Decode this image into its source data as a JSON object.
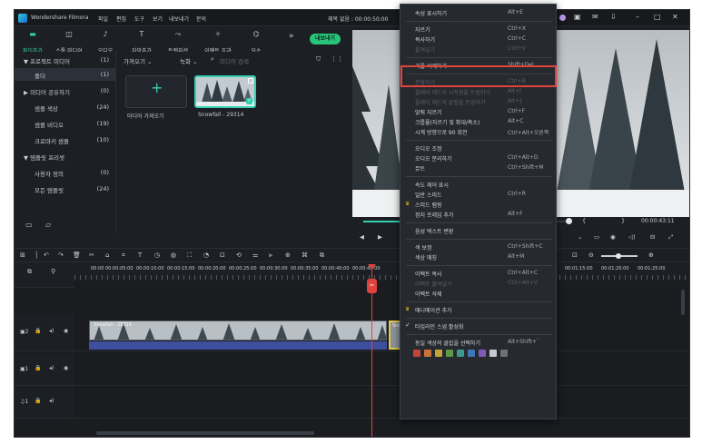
{
  "app": {
    "name": "Wondershare Filmora",
    "menus": [
      "파일",
      "편집",
      "도구",
      "보기",
      "내보내기",
      "문의"
    ],
    "project_title": "제목 없음 : 00:00:50:00"
  },
  "toolbar": {
    "tools": [
      {
        "label": "파일추가",
        "icon": "folder-icon",
        "active": true
      },
      {
        "label": "스톡 미디어",
        "icon": "stock-media-icon"
      },
      {
        "label": "오디오",
        "icon": "music-note-icon"
      },
      {
        "label": "자막추가",
        "icon": "text-icon"
      },
      {
        "label": "트랜지션",
        "icon": "transition-icon"
      },
      {
        "label": "이펙트 효과",
        "icon": "effects-icon"
      },
      {
        "label": "요소",
        "icon": "elements-icon"
      }
    ],
    "more": "»",
    "export_label": "내보내기"
  },
  "left_panel": {
    "items": [
      {
        "label": "▼ 프로젝트 미디어",
        "count": "(1)"
      },
      {
        "label": "폴더",
        "count": "(1)",
        "selected": true
      },
      {
        "label": "▶ 미디어 공유하기",
        "count": "(0)"
      },
      {
        "label": "샘플 색상",
        "count": "(24)"
      },
      {
        "label": "샘플 비디오",
        "count": "(19)"
      },
      {
        "label": "크로마키 샘플",
        "count": "(10)"
      },
      {
        "label": "▼ 템플릿 프리셋",
        "count": ""
      },
      {
        "label": "사용자 정의",
        "count": "(0)"
      },
      {
        "label": "모든 템플릿",
        "count": "(24)"
      }
    ]
  },
  "media": {
    "import_dropdown": "가져오기",
    "record_dropdown": "녹화",
    "search_placeholder": "미디어 검색",
    "import_label": "미디어 가져오기",
    "clip_name": "Snowfall - 29314"
  },
  "preview": {
    "timecode": "00:00:43:11",
    "brace_open": "{",
    "brace_close": "}"
  },
  "timeline": {
    "ruler_ticks": [
      "00:00",
      "00:00:05:00",
      "00:00:10:00",
      "00:00:15:00",
      "00:00:20:00",
      "00:00:25:00",
      "00:00:30:00",
      "00:00:35:00",
      "00:00:40:00",
      "00:00:45:00"
    ],
    "ruler_ticks_right": [
      "00:01:15:00",
      "00:01:20:00",
      "00:01:25:00"
    ],
    "clip1_name": "Snowfall - 29314",
    "clip2_name": "Sno",
    "tracks": [
      {
        "label": "2"
      },
      {
        "label": "1"
      },
      {
        "label": "1"
      }
    ]
  },
  "context_menu": {
    "items": [
      {
        "label": "속성 표시하기",
        "shortcut": "Alt+E",
        "enabled": true
      },
      {
        "sep": true
      },
      {
        "label": "자르기",
        "shortcut": "Ctrl+X",
        "enabled": true
      },
      {
        "label": "복사하기",
        "shortcut": "Ctrl+C",
        "enabled": true
      },
      {
        "label": "붙여넣기",
        "shortcut": "Ctrl+V",
        "enabled": false
      },
      {
        "sep": true
      },
      {
        "label": "리플 삭제하기",
        "shortcut": "Shift+Del",
        "enabled": true,
        "highlighted": true
      },
      {
        "sep": true
      },
      {
        "label": "분할하기",
        "shortcut": "Ctrl+B",
        "enabled": false
      },
      {
        "label": "플레이 헤드의 시작점을 트림하기",
        "shortcut": "Alt+[",
        "enabled": false
      },
      {
        "label": "플레이 헤드의 끝점을 트림하기",
        "shortcut": "Alt+]",
        "enabled": false
      },
      {
        "label": "맞춰 자르기",
        "shortcut": "Ctrl+F",
        "enabled": true
      },
      {
        "label": "크롭퓰(자르기 및 확대/축소)",
        "shortcut": "Alt+C",
        "enabled": true
      },
      {
        "label": "시계 방향으로 90 회전",
        "shortcut": "Ctrl+Alt+오른쪽",
        "enabled": true
      },
      {
        "sep": true
      },
      {
        "label": "오디오 조정",
        "shortcut": "",
        "enabled": true
      },
      {
        "label": "오디오 분리하기",
        "shortcut": "Ctrl+Alt+D",
        "enabled": true
      },
      {
        "label": "뮤트",
        "shortcut": "Ctrl+Shift+M",
        "enabled": true
      },
      {
        "sep": true
      },
      {
        "label": "속도 제어 표시",
        "shortcut": "",
        "enabled": true
      },
      {
        "label": "일반 스피드",
        "shortcut": "Ctrl+R",
        "enabled": true
      },
      {
        "label": "스피드 램핑",
        "shortcut": "",
        "enabled": true,
        "crown": true
      },
      {
        "label": "정지 프레임 추가",
        "shortcut": "Alt+F",
        "enabled": true
      },
      {
        "sep": true
      },
      {
        "label": "음성 텍스트 변환",
        "shortcut": "",
        "enabled": true
      },
      {
        "sep": true
      },
      {
        "label": "색 보정",
        "shortcut": "Ctrl+Shift+C",
        "enabled": true
      },
      {
        "label": "색상 매칭",
        "shortcut": "Alt+M",
        "enabled": true
      },
      {
        "sep": true
      },
      {
        "label": "이펙트 복사",
        "shortcut": "Ctrl+Alt+C",
        "enabled": true
      },
      {
        "label": "이펙트 붙여넣기",
        "shortcut": "Ctrl+Alt+V",
        "enabled": false
      },
      {
        "label": "이펙트 삭제",
        "shortcut": "",
        "enabled": true
      },
      {
        "sep": true
      },
      {
        "label": "애니메이션 추가",
        "shortcut": "",
        "enabled": true,
        "crown": true
      },
      {
        "sep": true
      },
      {
        "label": "타임라인 스냅 활성화",
        "shortcut": "",
        "enabled": true,
        "check": true
      },
      {
        "sep": true
      },
      {
        "label": "동일 색상의 클립을 선택하기",
        "shortcut": "Alt+Shift+`",
        "enabled": true
      }
    ],
    "swatches": [
      "#c0463c",
      "#c7743a",
      "#c2a33c",
      "#5a9a46",
      "#3e9a8e",
      "#3e76b8",
      "#7f5ab8",
      "#c7cbd1",
      "#6d7178"
    ]
  },
  "colors": {
    "accent": "#34d1b1",
    "export": "#28c47a",
    "playhead": "#e0433c",
    "highlight": "#e0433c"
  }
}
